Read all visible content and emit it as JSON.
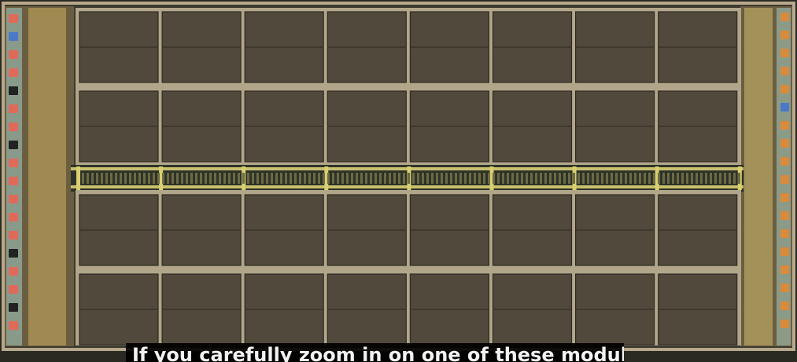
{
  "image": {
    "subject": "die-photo",
    "colors": {
      "frame": "#c8b59a",
      "background": "#2a2a22",
      "cell": "#51493c",
      "cell_edge": "#2f2a22",
      "grid_line": "#b9ad92",
      "center_strip": "#d9cf70",
      "periphery_left": "#7a6a48",
      "pad_red": "#e06a5a",
      "pad_orange": "#d98a3a",
      "pad_blue": "#4b79c8"
    },
    "array": {
      "columns": 8,
      "row_blocks": 4,
      "subrows_per_block": 2
    }
  },
  "caption": {
    "text": "If you carefully zoom in on one of these modules"
  }
}
